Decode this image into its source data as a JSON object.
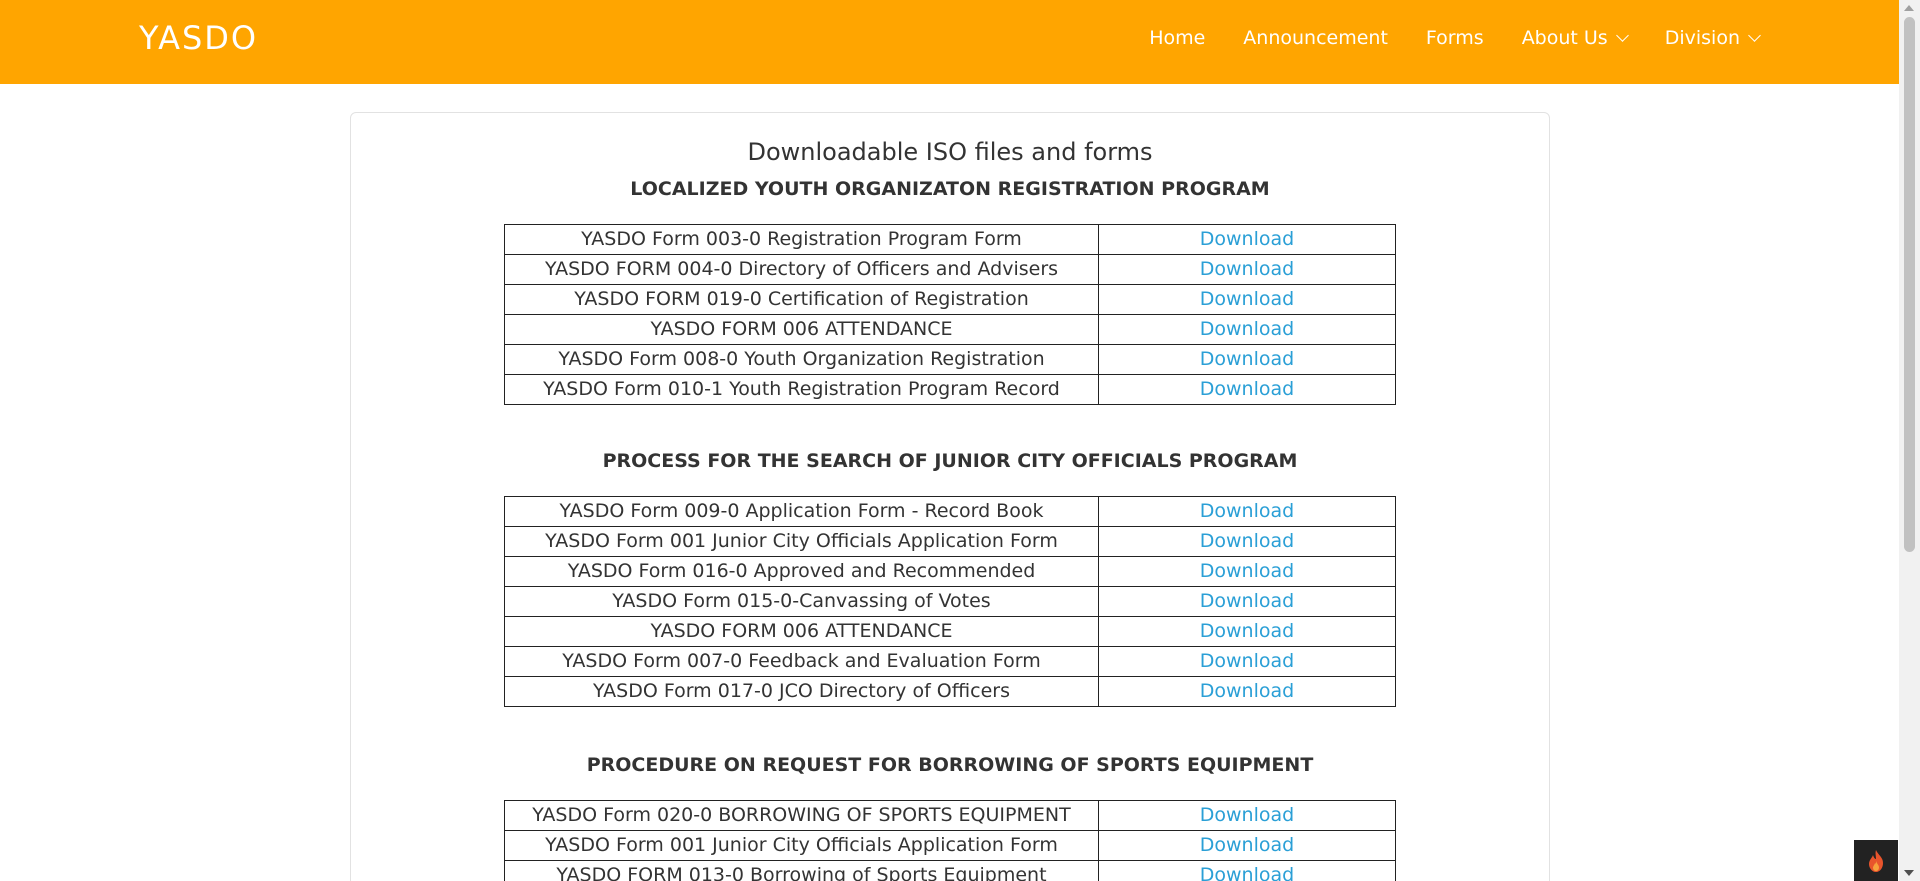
{
  "header": {
    "brand": "YASDO",
    "nav": [
      {
        "label": "Home",
        "dropdown": false
      },
      {
        "label": "Announcement",
        "dropdown": false
      },
      {
        "label": "Forms",
        "dropdown": false
      },
      {
        "label": "About Us",
        "dropdown": true
      },
      {
        "label": "Division",
        "dropdown": true
      }
    ]
  },
  "main": {
    "title": "Downloadable ISO files and forms",
    "download_label": "Download",
    "sections": [
      {
        "title": "LOCALIZED YOUTH ORGANIZATON REGISTRATION PROGRAM",
        "forms": [
          "YASDO Form 003-0 Registration Program Form",
          "YASDO FORM 004-0 Directory of Officers and Advisers",
          "YASDO FORM 019-0 Certification of Registration",
          "YASDO FORM 006 ATTENDANCE",
          "YASDO Form 008-0 Youth Organization Registration",
          "YASDO Form 010-1 Youth Registration Program Record"
        ]
      },
      {
        "title": "PROCESS FOR THE SEARCH OF JUNIOR CITY OFFICIALS PROGRAM",
        "forms": [
          "YASDO Form 009-0 Application Form - Record Book",
          "YASDO Form 001 Junior City Officials Application Form",
          "YASDO Form 016-0 Approved and Recommended",
          "YASDO Form 015-0-Canvassing of Votes",
          "YASDO FORM 006 ATTENDANCE",
          "YASDO Form 007-0 Feedback and Evaluation Form",
          "YASDO Form 017-0 JCO Directory of Officers"
        ]
      },
      {
        "title": "PROCEDURE ON REQUEST FOR BORROWING OF SPORTS EQUIPMENT",
        "forms": [
          "YASDO Form 020-0 BORROWING OF SPORTS EQUIPMENT",
          "YASDO Form 001 Junior City Officials Application Form",
          "YASDO FORM 013-0 Borrowing of Sports Equipment"
        ]
      }
    ]
  },
  "colors": {
    "header_bg": "#ffa500",
    "link": "#2a9fd6",
    "text": "#333333"
  },
  "icons": {
    "fab": "fire-icon",
    "nav_dropdown": "chevron-down-icon"
  }
}
